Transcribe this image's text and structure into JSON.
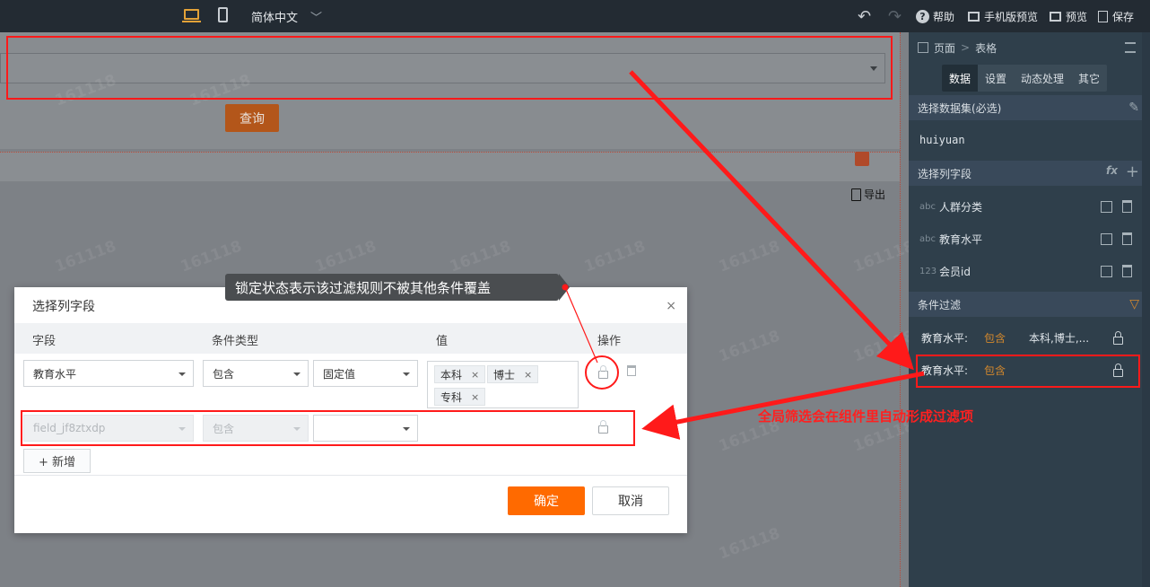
{
  "topbar": {
    "language": "简体中文",
    "help": "帮助",
    "mobile_preview": "手机版预览",
    "preview": "预览",
    "save": "保存"
  },
  "canvas": {
    "query_button": "查询",
    "export_label": "导出",
    "watermark": "161118"
  },
  "right_panel": {
    "breadcrumb": {
      "page": "页面",
      "sep": ">",
      "current": "表格"
    },
    "tabs": [
      "数据",
      "设置",
      "动态处理",
      "其它"
    ],
    "active_tab": "数据",
    "dataset_section": "选择数据集(必选)",
    "dataset_value": "huiyuan",
    "columns_section": "选择列字段",
    "columns": [
      {
        "type": "abc",
        "name": "人群分类"
      },
      {
        "type": "abc",
        "name": "教育水平"
      },
      {
        "type": "123",
        "name": "会员id"
      }
    ],
    "filter_section": "条件过滤",
    "filters": [
      {
        "field": "教育水平:",
        "op": "包含",
        "value": "本科,博士,..."
      },
      {
        "field": "教育水平:",
        "op": "包含",
        "value": ""
      }
    ]
  },
  "dialog": {
    "title": "选择列字段",
    "close": "×",
    "headers": {
      "field": "字段",
      "cond_type": "条件类型",
      "value": "值",
      "action": "操作"
    },
    "row1": {
      "field": "教育水平",
      "cond": "包含",
      "value_type": "固定值",
      "tags": [
        "本科",
        "博士",
        "专科"
      ]
    },
    "row2": {
      "field": "field_jf8ztxdp",
      "cond": "包含",
      "value_type": ""
    },
    "add_button": "+ 新增",
    "ok_button": "确定",
    "cancel_button": "取消"
  },
  "annotations": {
    "tooltip": "锁定状态表示该过滤规则不被其他条件覆盖",
    "global_filter_note": "全局筛选会在组件里自动形成过滤项"
  },
  "colors": {
    "accent_orange": "#ff6a00",
    "annotation_red": "#ff1a1a",
    "panel_bg": "#2f3f4b",
    "topbar_bg": "#232b33"
  }
}
